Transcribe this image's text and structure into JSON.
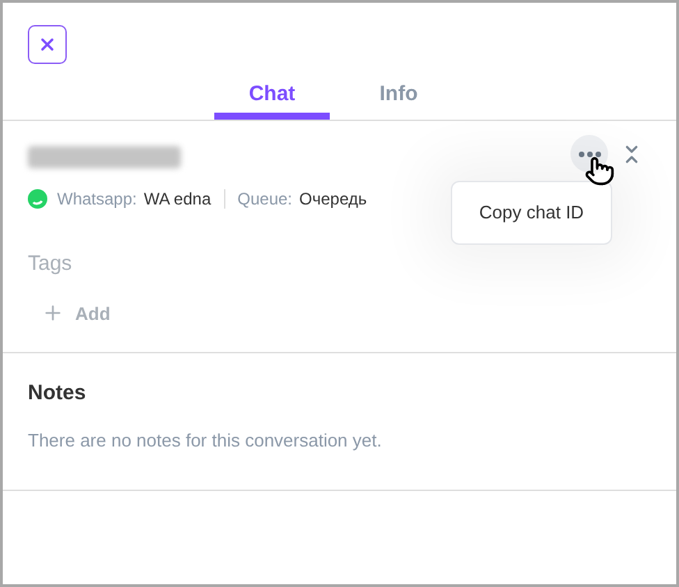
{
  "tabs": [
    {
      "label": "Chat",
      "selected": true
    },
    {
      "label": "Info",
      "selected": false
    }
  ],
  "conversation": {
    "channel_label": "Whatsapp:",
    "channel_value": "WA edna",
    "queue_label": "Queue:",
    "queue_value": "Очередь"
  },
  "menu": {
    "items": [
      "Copy chat ID"
    ]
  },
  "tags": {
    "title": "Tags",
    "add_label": "Add"
  },
  "notes": {
    "title": "Notes",
    "empty_text": "There are no notes for this conversation yet."
  }
}
